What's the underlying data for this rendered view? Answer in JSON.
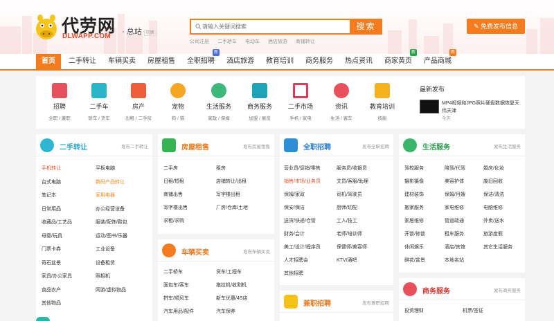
{
  "header": {
    "logo_cn": "代劳网",
    "logo_en": "DLWAPP.COM",
    "station": "总站",
    "station_tag": "切换",
    "search_placeholder": "请输入关键词搜索",
    "search_button": "搜索",
    "hot": [
      "公司注册",
      "二手轿车",
      "电动车",
      "酒店旅游",
      "商铺转让"
    ],
    "post_button": "免费发布信息"
  },
  "nav": [
    "首页",
    "二手转让",
    "车辆买卖",
    "房屋租售",
    "全职招聘",
    "酒店旅游",
    "教育培训",
    "商务服务",
    "热点资讯",
    "商家黄页",
    "产品商城"
  ],
  "nav_badges": {
    "zhaopin": "新",
    "huangye": "新",
    "shangcheng": "新"
  },
  "categories": [
    {
      "name": "招聘",
      "sub": "全职 / 兼职"
    },
    {
      "name": "二手车",
      "sub": "轿车 / 货车"
    },
    {
      "name": "房产",
      "sub": "出租 / 二手房"
    },
    {
      "name": "宠物",
      "sub": "狗 / 猫"
    },
    {
      "name": "生活服务",
      "sub": "家政 / 保姆"
    },
    {
      "name": "商务服务",
      "sub": "加盟 / 展览"
    },
    {
      "name": "二手市场",
      "sub": "手机 / 家电"
    },
    {
      "name": "资讯",
      "sub": "生活 / 客车"
    },
    {
      "name": "教育培训",
      "sub": "技能"
    }
  ],
  "news": {
    "title": "最新发布",
    "item": "MP4视频和JPG照片硬盘数据恢复天伟天津",
    "date": "今天"
  },
  "panels": {
    "ershou": {
      "title": "二手转让",
      "post": "发布二手转让",
      "items": [
        "手机转让",
        "平板电脑",
        "台式电脑",
        "数码产品转让",
        "笔记本",
        "家用电器",
        "日常用品",
        "办公经营设备",
        "收藏品/工艺品",
        "服装/配饰/鞋包",
        "母婴/玩具",
        "运动/图书/乐器",
        "门票卡券",
        "工业设备",
        "奇石盆景",
        "设备租赁",
        "家具/办公家具",
        "照相机",
        "食品农产",
        "网游/虚拟物品",
        "其他物品"
      ]
    },
    "fangwu": {
      "title": "房屋租售",
      "post": "发布房屋租售",
      "items": [
        "二手房",
        "租房",
        "日租/短租",
        "店铺转让/出租",
        "商铺出售",
        "写字楼出租",
        "写字楼出售",
        "厂房/仓库/土地",
        "求租/求购"
      ]
    },
    "cheliang": {
      "title": "车辆买卖",
      "post": "发布车辆买卖",
      "items": [
        "二手轿车",
        "货车/工程车",
        "面包车/客车",
        "拖拉机/收割机",
        "拼车/顺风车",
        "新车优惠/4S店",
        "汽车用品/配件",
        "汽车保养"
      ]
    },
    "zhaopin": {
      "title": "全职招聘",
      "post": "发布全职招聘",
      "items": [
        "营业员/促销/零售",
        "服务员/收银员",
        "销售/市场/业务员",
        "文员/客服/助理",
        "保姆/家政",
        "司机/驾驶员",
        "保安/保洁",
        "厨师/切配",
        "送货/快递/仓管",
        "工人/技工",
        "财务/会计",
        "老师/培训师",
        "美工/设计/程序员",
        "保健师/美容师",
        "人才招聘会",
        "KTV/酒吧",
        "其他招聘"
      ]
    },
    "jianzhi": {
      "title": "兼职招聘",
      "post": "发布兼职招聘"
    },
    "shenghuo": {
      "title": "生活服务",
      "post": "发布生活服务",
      "items": [
        "驾校服务",
        "陪驾/代驾",
        "婚庆/化妆",
        "摄影摄像",
        "美容护体",
        "废旧回收",
        "建材装饰",
        "保姆/月嫂",
        "保洁/清洗",
        "搬家服务",
        "家电维修",
        "电脑维修",
        "家居维修",
        "管道疏通",
        "外卖/送水",
        "开锁/修锁",
        "租车服务",
        "旅游度假",
        "休闲娱乐",
        "酒店/宾馆",
        "其它生活服务",
        "鲜花/盆景",
        "本地名站"
      ]
    },
    "shangwu": {
      "title": "商务服务",
      "post": "发布商务服务",
      "items": [
        "投资理财",
        "机票/签证"
      ]
    }
  }
}
